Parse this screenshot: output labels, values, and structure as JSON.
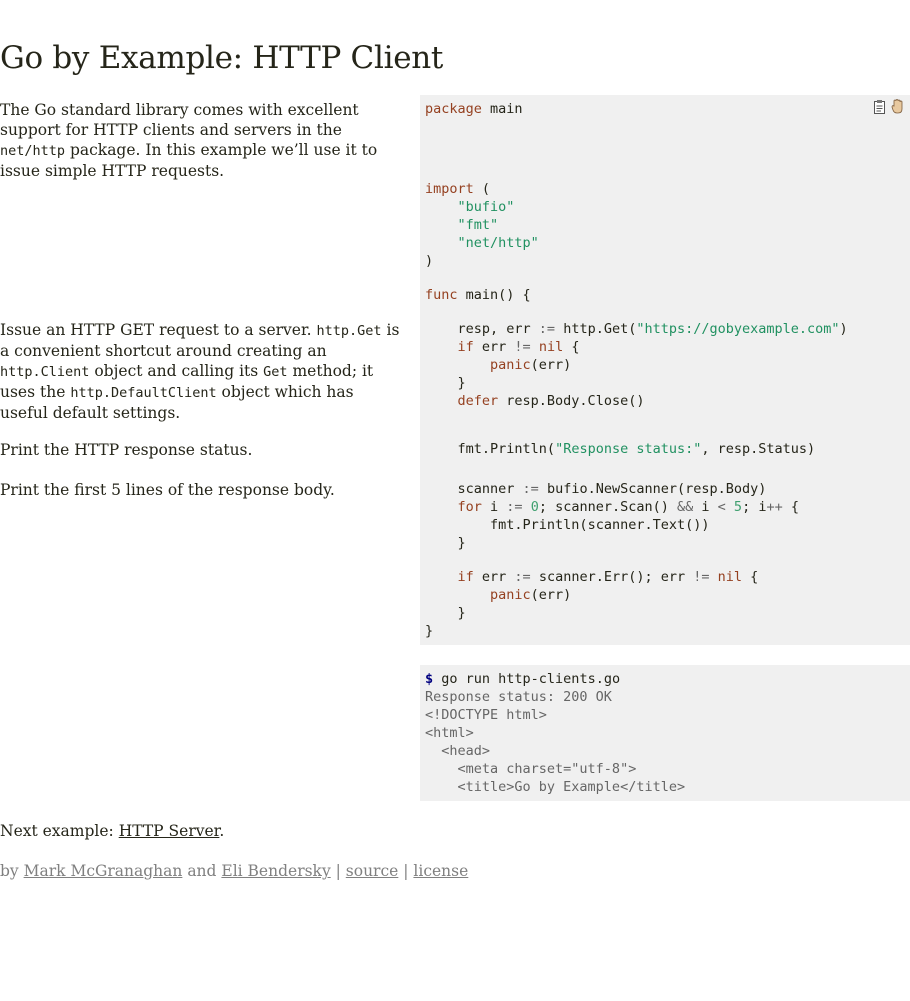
{
  "page": {
    "title": "Go by Example: HTTP Client"
  },
  "docs": {
    "intro_1": "The Go standard library comes with excellent support for HTTP clients and servers in the ",
    "intro_code": "net/http",
    "intro_2": " package. In this example we’ll use it to issue simple HTTP requests.",
    "get_1": "Issue an HTTP GET request to a server. ",
    "get_code1": "http.Get",
    "get_2": " is a convenient shortcut around creating an ",
    "get_code2": "http.Client",
    "get_3": " object and calling its ",
    "get_code3": "Get",
    "get_4": " method; it uses the ",
    "get_code4": "http.DefaultClient",
    "get_5": " object which has useful default settings.",
    "status": "Print the HTTP response status.",
    "body": "Print the first 5 lines of the response body."
  },
  "code": {
    "pkg_kw": "package",
    "pkg_name": " main",
    "import_kw": "import",
    "import_open": " (",
    "imp1": "\"bufio\"",
    "imp2": "\"fmt\"",
    "imp3": "\"net/http\"",
    "import_close": ")",
    "func_kw": "func",
    "func_sig": " main() {",
    "l1_a": "resp, err ",
    "l1_op": ":=",
    "l1_b": " http.Get(",
    "l1_str": "\"https://gobyexample.com\"",
    "l1_c": ")",
    "l2_kw": "if",
    "l2_a": " err ",
    "l2_op": "!=",
    "l2_nil": " nil",
    "l2_b": " {",
    "l3_fn": "panic",
    "l3_a": "(err)",
    "l4": "}",
    "l5_kw": "defer",
    "l5_a": " resp.Body.Close()",
    "l6_a": "fmt.Println(",
    "l6_str": "\"Response status:\"",
    "l6_b": ", resp.Status)",
    "l7_a": "scanner ",
    "l7_op": ":=",
    "l7_b": " bufio.NewScanner(resp.Body)",
    "l8_kw": "for",
    "l8_a": " i ",
    "l8_op1": ":=",
    "l8_n0": " 0",
    "l8_b": "; scanner.Scan() ",
    "l8_op2": "&&",
    "l8_c": " i ",
    "l8_op3": "<",
    "l8_n5": " 5",
    "l8_d": "; i",
    "l8_op4": "++",
    "l8_e": " {",
    "l9": "fmt.Println(scanner.Text())",
    "l10": "}",
    "l11_kw": "if",
    "l11_a": " err ",
    "l11_op": ":=",
    "l11_b": " scanner.Err(); err ",
    "l11_op2": "!=",
    "l11_nil": " nil",
    "l11_c": " {",
    "l12_fn": "panic",
    "l12_a": "(err)",
    "l13": "}",
    "l14": "}"
  },
  "output": {
    "prompt": "$",
    "cmd": " go run http-clients.go",
    "lines": [
      "Response status: 200 OK",
      "<!DOCTYPE html>",
      "<html>",
      "  <head>",
      "    <meta charset=\"utf-8\">",
      "    <title>Go by Example</title>"
    ]
  },
  "next": {
    "prefix": "Next example: ",
    "link": "HTTP Server",
    "suffix": "."
  },
  "footer": {
    "by": "by ",
    "author1": "Mark McGranaghan",
    "and": " and ",
    "author2": "Eli Bendersky",
    "sep1": " | ",
    "source": "source",
    "sep2": " | ",
    "license": "license"
  }
}
